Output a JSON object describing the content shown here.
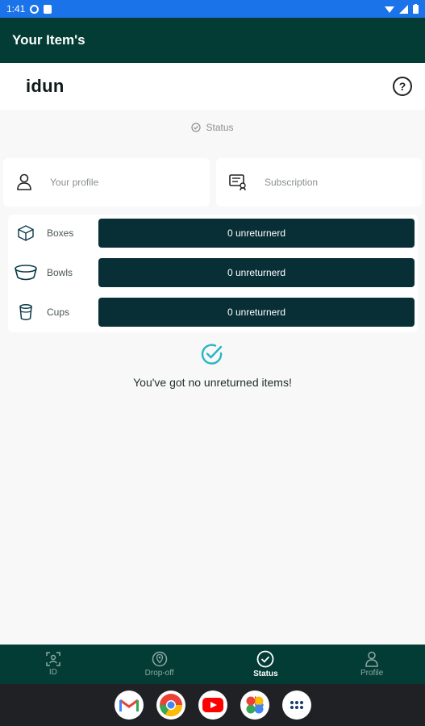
{
  "status_bar": {
    "time": "1:41"
  },
  "app_bar": {
    "title": "Your Item's"
  },
  "brand": {
    "name": "idun"
  },
  "status_section": {
    "label": "Status"
  },
  "cards": [
    {
      "label": "Your profile",
      "icon": "person-icon"
    },
    {
      "label": "Subscription",
      "icon": "subscription-icon"
    }
  ],
  "items": [
    {
      "label": "Boxes",
      "icon": "box-icon",
      "value": "0 unreturnerd"
    },
    {
      "label": "Bowls",
      "icon": "bowl-icon",
      "value": "0 unreturnerd"
    },
    {
      "label": "Cups",
      "icon": "cup-icon",
      "value": "0 unreturnerd"
    }
  ],
  "message": "You've got no unreturned items!",
  "bottom_nav": [
    {
      "label": "ID",
      "icon": "id-icon",
      "active": false
    },
    {
      "label": "Drop-off",
      "icon": "location-icon",
      "active": false
    },
    {
      "label": "Status",
      "icon": "check-circle-icon",
      "active": true
    },
    {
      "label": "Profile",
      "icon": "person-icon",
      "active": false
    }
  ],
  "dock_apps": [
    "gmail-icon",
    "chrome-icon",
    "youtube-icon",
    "photos-icon",
    "apps-icon"
  ],
  "colors": {
    "primary": "#033c35",
    "pill": "#082f36",
    "accent": "#26b5c4",
    "status_bar": "#1a73e8"
  }
}
